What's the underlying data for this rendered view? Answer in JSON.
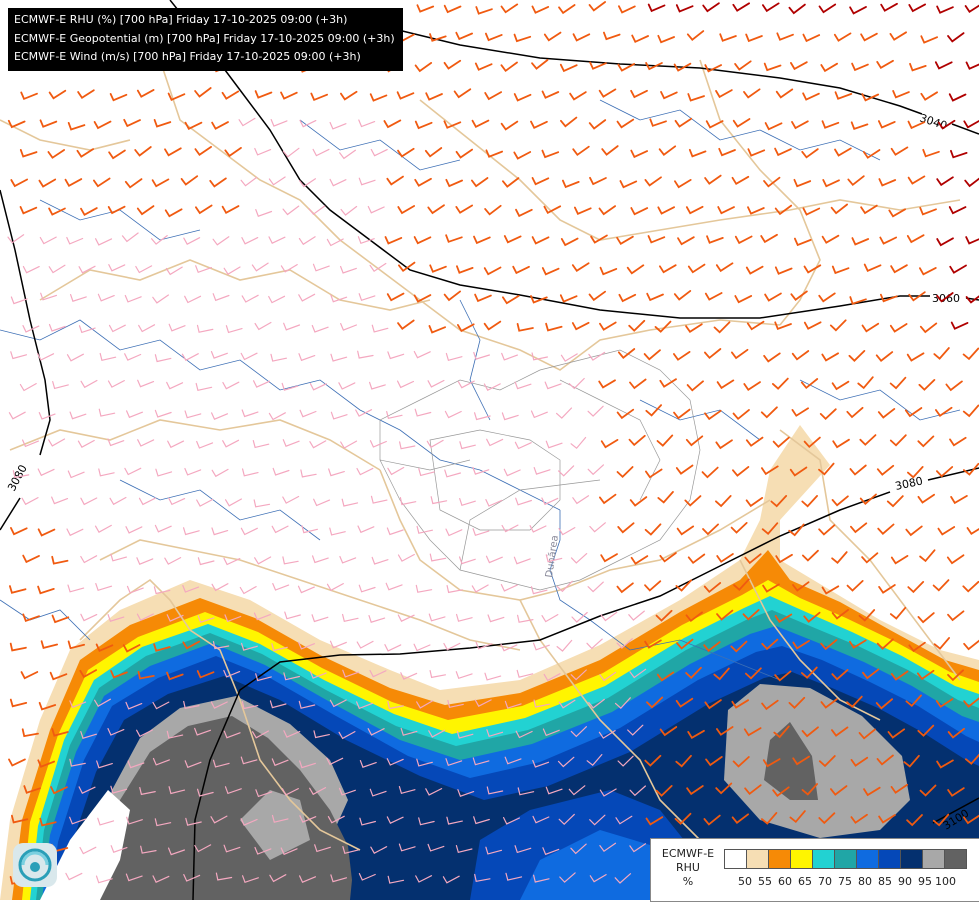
{
  "info": {
    "line1": "ECMWF-E RHU (%) [700 hPa] Friday 17-10-2025 09:00 (+3h)",
    "line2": "ECMWF-E Geopotential (m) [700 hPa] Friday 17-10-2025 09:00 (+3h)",
    "line3": "ECMWF-E Wind (m/s) [700 hPa] Friday 17-10-2025 09:00 (+3h)"
  },
  "contours": {
    "c3040": "3040",
    "c3060": "3060",
    "c3080_left": "3080",
    "c3080_right": "3080",
    "c3100": "3100"
  },
  "river_label": "Dunărea",
  "legend": {
    "title_line1": "ECMWF-E",
    "title_line2": "RHU",
    "title_line3": "%",
    "colors": [
      "#ffffff",
      "#f6deb4",
      "#f68a06",
      "#fff500",
      "#22d2d2",
      "#20a6a6",
      "#0f6be0",
      "#0548b8",
      "#04306f",
      "#a8a8a8",
      "#626262"
    ],
    "ticks": [
      "50",
      "55",
      "60",
      "65",
      "70",
      "75",
      "80",
      "85",
      "90",
      "95",
      "100"
    ]
  },
  "colors": {
    "wind_strong": "#f05a10",
    "wind_weak": "#f4a8c0",
    "wind_extreme": "#b00000",
    "isohypse": "#000000",
    "border": "#e4c79a",
    "river": "#3d6fb5",
    "admin": "#999999"
  },
  "icons": [
    "logo-icon"
  ]
}
